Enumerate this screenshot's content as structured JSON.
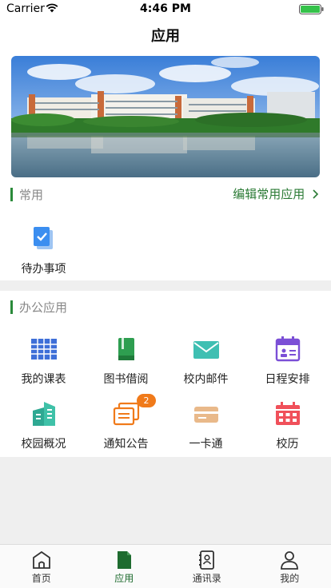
{
  "status_bar": {
    "carrier": "Carrier",
    "time": "4:46 PM"
  },
  "nav": {
    "title": "应用"
  },
  "common": {
    "title": "常用",
    "edit_label": "编辑常用应用",
    "items": [
      {
        "label": "待办事项",
        "icon": "todo-icon"
      }
    ]
  },
  "office": {
    "title": "办公应用",
    "items": [
      {
        "label": "我的课表",
        "icon": "timetable-icon"
      },
      {
        "label": "图书借阅",
        "icon": "book-icon"
      },
      {
        "label": "校内邮件",
        "icon": "mail-icon"
      },
      {
        "label": "日程安排",
        "icon": "calendar-icon"
      },
      {
        "label": "校园概况",
        "icon": "buildings-icon"
      },
      {
        "label": "通知公告",
        "icon": "notice-icon",
        "badge": "2"
      },
      {
        "label": "一卡通",
        "icon": "card-icon"
      },
      {
        "label": "校历",
        "icon": "school-calendar-icon"
      }
    ]
  },
  "tabbar": {
    "items": [
      {
        "label": "首页",
        "icon": "home-icon"
      },
      {
        "label": "应用",
        "icon": "apps-icon",
        "active": true
      },
      {
        "label": "通讯录",
        "icon": "contacts-icon"
      },
      {
        "label": "我的",
        "icon": "profile-icon"
      }
    ]
  },
  "colors": {
    "accent": "#2a7a34",
    "badge": "#f07a1a"
  }
}
